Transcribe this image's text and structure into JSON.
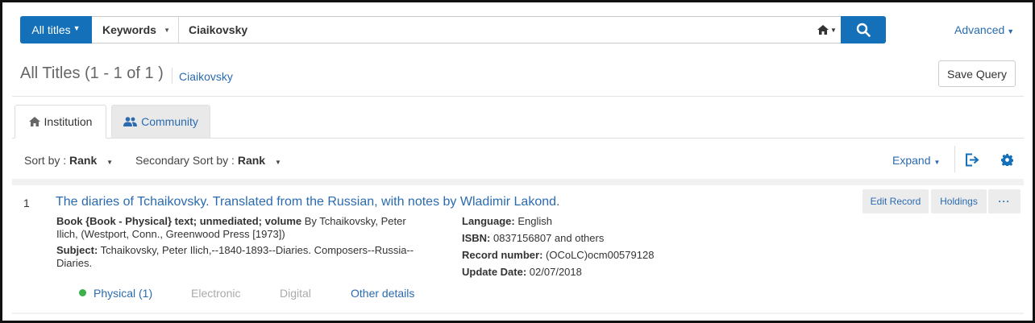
{
  "search": {
    "scope_label": "All titles",
    "field_label": "Keywords",
    "query_value": "Ciaikovsky",
    "advanced_label": "Advanced"
  },
  "results": {
    "title": "All Titles (1 - 1 of 1 )",
    "query_link": "Ciaikovsky",
    "save_query_label": "Save Query"
  },
  "tabs": [
    {
      "label": "Institution"
    },
    {
      "label": "Community"
    }
  ],
  "sort": {
    "sort_by_label": "Sort by :",
    "sort_by_value": "Rank",
    "secondary_label": "Secondary Sort by :",
    "secondary_value": "Rank",
    "expand_label": "Expand"
  },
  "record": {
    "number": "1",
    "title": "The diaries of Tchaikovsky. Translated from the Russian, with notes by Wladimir Lakond.",
    "type_bold": "Book {Book - Physical} text; unmediated; volume",
    "type_rest_line1": " By Tchaikovsky, Peter",
    "type_line2": "Ilich, (Westport, Conn., Greenwood Press [1973])",
    "subject_label": "Subject:",
    "subject_line1": " Tchaikovsky, Peter Ilich,--1840-1893--Diaries. Composers--Russia--",
    "subject_line2": "Diaries.",
    "language_label": "Language:",
    "language_value": " English",
    "isbn_label": "ISBN:",
    "isbn_value": " 0837156807 and others",
    "record_number_label": "Record number:",
    "record_number_value": " (OCoLC)ocm00579128",
    "update_date_label": "Update Date:",
    "update_date_value": " 02/07/2018",
    "actions": {
      "edit_record": "Edit Record",
      "holdings": "Holdings",
      "more": "···"
    },
    "bottom_tabs": {
      "physical": "Physical (1)",
      "electronic": "Electronic",
      "digital": "Digital",
      "other": "Other details"
    }
  },
  "colors": {
    "primary": "#1470b8",
    "link": "#2a6bb0",
    "available": "#3cb04a"
  }
}
